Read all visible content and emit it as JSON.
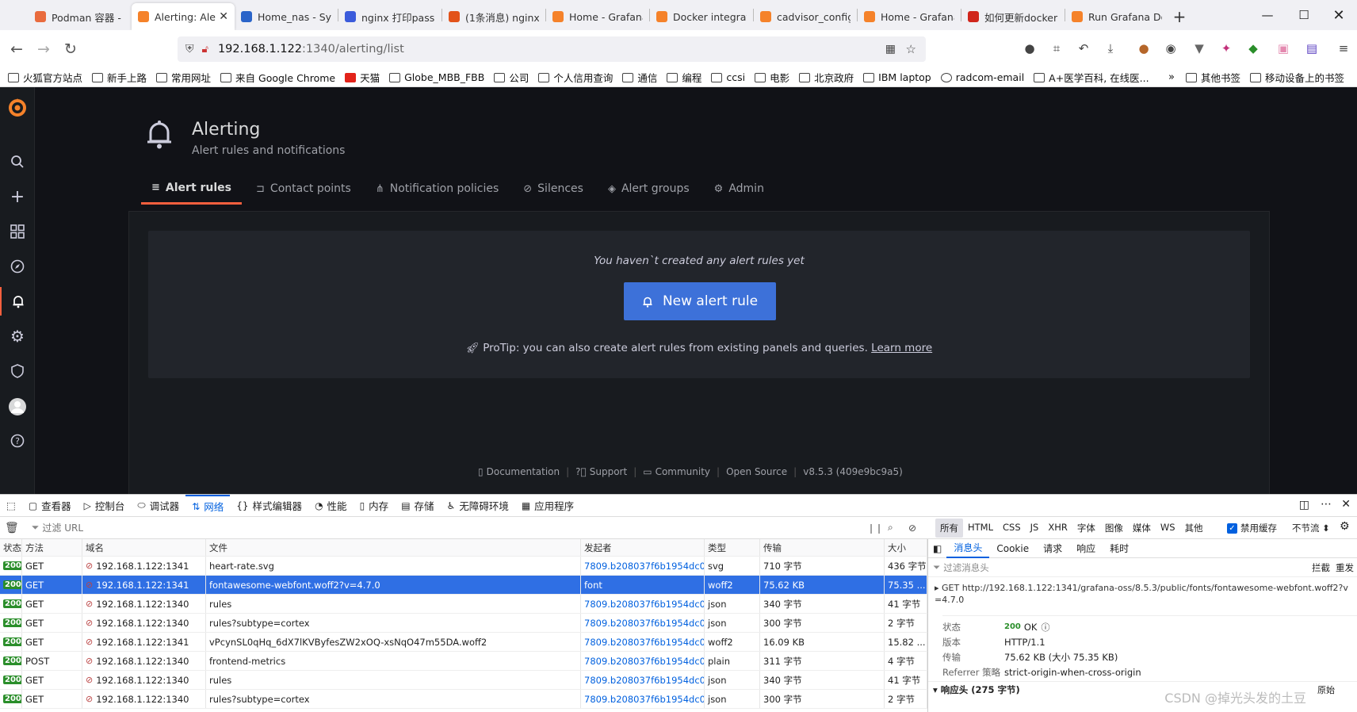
{
  "browser": {
    "tabs": [
      {
        "title": "Podman 容器 - ",
        "color": "#e96b3d",
        "active": false
      },
      {
        "title": "Alerting: Aler",
        "color": "#f5822a",
        "active": true
      },
      {
        "title": "Home_nas - Sy",
        "color": "#2a64c9",
        "active": false
      },
      {
        "title": "nginx 打印pass",
        "color": "#3b5bdb",
        "active": false
      },
      {
        "title": "(1条消息) nginx",
        "color": "#e2531a",
        "active": false
      },
      {
        "title": "Home - Grafana",
        "color": "#f5822a",
        "active": false
      },
      {
        "title": "Docker integrat",
        "color": "#f5822a",
        "active": false
      },
      {
        "title": "cadvisor_config",
        "color": "#f5822a",
        "active": false
      },
      {
        "title": "Home - Grafana",
        "color": "#f5822a",
        "active": false
      },
      {
        "title": "如何更新docker",
        "color": "#d0261c",
        "active": false
      },
      {
        "title": "Run Grafana Do",
        "color": "#f5822a",
        "active": false
      }
    ],
    "url_host": "192.168.1.122",
    "url_path": ":1340/alerting/list",
    "bookmarks": [
      "火狐官方站点",
      "新手上路",
      "常用网址",
      "来自 Google Chrome",
      "天猫",
      "Globe_MBB_FBB",
      "公司",
      "个人信用查询",
      "通信",
      "编程",
      "ccsi",
      "电影",
      "北京政府",
      "IBM laptop",
      "radcom-email",
      "A+医学百科, 在线医..."
    ],
    "bookmarks_right": [
      "其他书签",
      "移动设备上的书签"
    ]
  },
  "grafana": {
    "title": "Alerting",
    "subtitle": "Alert rules and notifications",
    "tabs": [
      {
        "label": "Alert rules",
        "icon": "≡",
        "active": true
      },
      {
        "label": "Contact points",
        "icon": "⊐",
        "active": false
      },
      {
        "label": "Notification policies",
        "icon": "⋔",
        "active": false
      },
      {
        "label": "Silences",
        "icon": "⊘",
        "active": false
      },
      {
        "label": "Alert groups",
        "icon": "◈",
        "active": false
      },
      {
        "label": "Admin",
        "icon": "⚙",
        "active": false
      }
    ],
    "empty_message": "You haven`t created any alert rules yet",
    "new_rule_label": "New alert rule",
    "protip": "ProTip: you can also create alert rules from existing panels and queries.",
    "learn_more": "Learn more",
    "footer": [
      "Documentation",
      "Support",
      "Community",
      "Open Source",
      "v8.5.3 (409e9bc9a5)"
    ],
    "accent": "#f55f3e",
    "button_color": "#3d71d9"
  },
  "devtools": {
    "tabs": [
      "查看器",
      "控制台",
      "调试器",
      "网络",
      "样式编辑器",
      "性能",
      "内存",
      "存储",
      "无障碍环境",
      "应用程序"
    ],
    "active_tab": "网络",
    "filter_placeholder": "过滤 URL",
    "type_filters": [
      "所有",
      "HTML",
      "CSS",
      "JS",
      "XHR",
      "字体",
      "图像",
      "媒体",
      "WS",
      "其他"
    ],
    "disable_cache": "禁用缓存",
    "throttle": "不节流 ⬍",
    "columns": [
      "状态",
      "方法",
      "域名",
      "文件",
      "发起者",
      "类型",
      "传输",
      "大小"
    ],
    "rows": [
      {
        "status": "200",
        "method": "GET",
        "domain": "192.168.1.122:1341",
        "file": "heart-rate.svg",
        "initiator": "7809.b208037f6b1954dc0...",
        "type": "svg",
        "transfer": "710 字节",
        "size": "436 字节",
        "selected": false
      },
      {
        "status": "200",
        "method": "GET",
        "domain": "192.168.1.122:1341",
        "file": "fontawesome-webfont.woff2?v=4.7.0",
        "initiator": "font",
        "type": "woff2",
        "transfer": "75.62 KB",
        "size": "75.35 ...",
        "selected": true
      },
      {
        "status": "200",
        "method": "GET",
        "domain": "192.168.1.122:1340",
        "file": "rules",
        "initiator": "7809.b208037f6b1954dc0...",
        "type": "json",
        "transfer": "340 字节",
        "size": "41 字节",
        "selected": false
      },
      {
        "status": "200",
        "method": "GET",
        "domain": "192.168.1.122:1340",
        "file": "rules?subtype=cortex",
        "initiator": "7809.b208037f6b1954dc0...",
        "type": "json",
        "transfer": "300 字节",
        "size": "2 字节",
        "selected": false
      },
      {
        "status": "200",
        "method": "GET",
        "domain": "192.168.1.122:1341",
        "file": "vPcynSL0qHq_6dX7lKVByfesZW2xOQ-xsNqO47m55DA.woff2",
        "initiator": "7809.b208037f6b1954dc0...",
        "type": "woff2",
        "transfer": "16.09 KB",
        "size": "15.82 ...",
        "selected": false
      },
      {
        "status": "200",
        "method": "POST",
        "domain": "192.168.1.122:1340",
        "file": "frontend-metrics",
        "initiator": "7809.b208037f6b1954dc0...",
        "type": "plain",
        "transfer": "311 字节",
        "size": "4 字节",
        "selected": false
      },
      {
        "status": "200",
        "method": "GET",
        "domain": "192.168.1.122:1340",
        "file": "rules",
        "initiator": "7809.b208037f6b1954dc0...",
        "type": "json",
        "transfer": "340 字节",
        "size": "41 字节",
        "selected": false
      },
      {
        "status": "200",
        "method": "GET",
        "domain": "192.168.1.122:1340",
        "file": "rules?subtype=cortex",
        "initiator": "7809.b208037f6b1954dc0...",
        "type": "json",
        "transfer": "300 字节",
        "size": "2 字节",
        "selected": false
      }
    ],
    "detail_tabs": [
      "消息头",
      "Cookie",
      "请求",
      "响应",
      "耗时"
    ],
    "detail_filter": "过滤消息头",
    "detail_actions": [
      "拦截",
      "重发"
    ],
    "request_line": "GET http://192.168.1.122:1341/grafana-oss/8.5.3/public/fonts/fontawesome-webfont.woff2?v=4.7.0",
    "details": [
      {
        "k": "状态",
        "v": "OK"
      },
      {
        "k": "版本",
        "v": "HTTP/1.1"
      },
      {
        "k": "传输",
        "v": "75.62 KB (大小 75.35 KB)"
      },
      {
        "k": "Referrer 策略",
        "v": "strict-origin-when-cross-origin"
      }
    ],
    "status_code": "200",
    "response_headers": "响应头 (275 字节)",
    "raw": "原始"
  },
  "watermark": "CSDN @掉光头发的土豆"
}
